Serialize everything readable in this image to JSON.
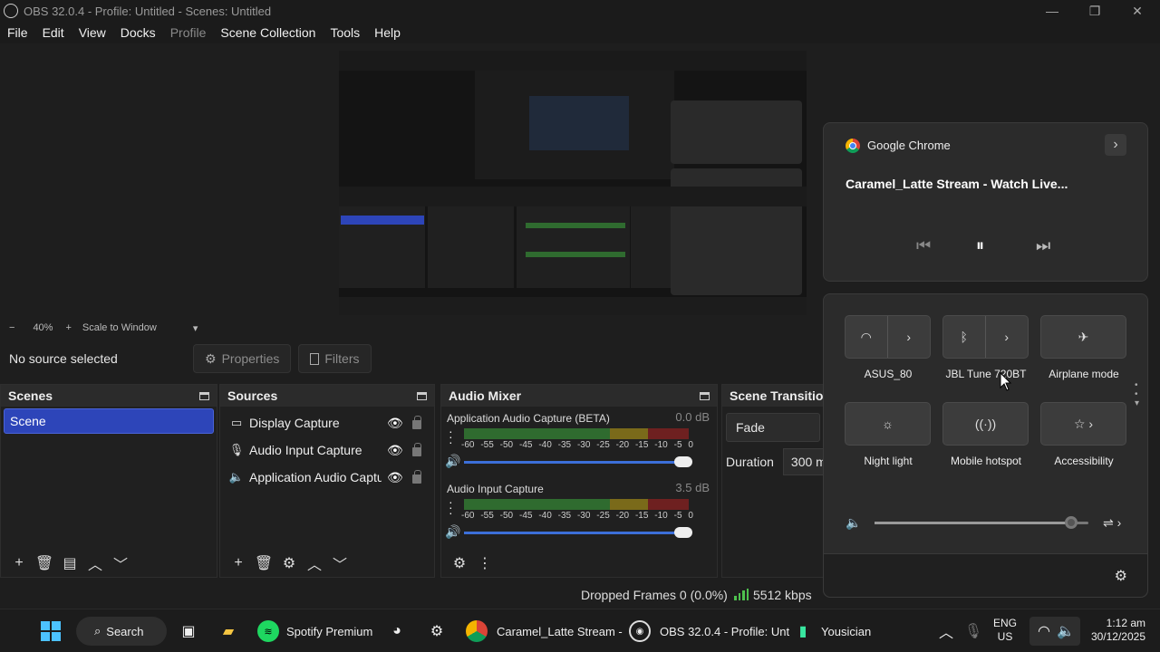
{
  "window": {
    "title": "OBS 32.0.4 - Profile: Untitled - Scenes: Untitled",
    "minimize": "—",
    "restore": "❐",
    "close": "✕"
  },
  "menu": [
    "File",
    "Edit",
    "View",
    "Docks",
    "Profile",
    "Scene Collection",
    "Tools",
    "Help"
  ],
  "preview": {
    "zoom_minus": "−",
    "zoom": "40%",
    "zoom_plus": "+",
    "scale_mode": "Scale to Window",
    "dropdown": "▾"
  },
  "context": {
    "no_source": "No source selected",
    "properties": "Properties",
    "filters": "Filters"
  },
  "scenes": {
    "title": "Scenes",
    "items": [
      "Scene"
    ]
  },
  "sources": {
    "title": "Sources",
    "items": [
      {
        "label": "Display Capture",
        "icon": "monitor-icon"
      },
      {
        "label": "Audio Input Capture",
        "icon": "microphone-icon"
      },
      {
        "label": "Application Audio Capture",
        "icon": "app-audio-icon"
      }
    ]
  },
  "mixer": {
    "title": "Audio Mixer",
    "ticks": [
      "-60",
      "-55",
      "-50",
      "-45",
      "-40",
      "-35",
      "-30",
      "-25",
      "-20",
      "-15",
      "-10",
      "-5",
      "0"
    ],
    "channels": [
      {
        "name": "Application Audio Capture (BETA)",
        "db": "0.0 dB",
        "volume": 1.0
      },
      {
        "name": "Audio Input Capture",
        "db": "3.5 dB",
        "volume": 1.0
      }
    ]
  },
  "transitions": {
    "title": "Scene Transition",
    "selected": "Fade",
    "duration_label": "Duration",
    "duration_value": "300 m"
  },
  "status": {
    "dropped": "Dropped Frames 0 (0.0%)",
    "kbps": "5512 kbps"
  },
  "media": {
    "app": "Google Chrome",
    "title": "Caramel_Latte Stream - Watch Live...",
    "prev": "⏮",
    "pause": "⏸",
    "next": "⏭",
    "expand": "›"
  },
  "quick_settings": {
    "tiles": [
      {
        "label": "ASUS_80",
        "icon": "wifi-icon"
      },
      {
        "label": "JBL Tune 720BT",
        "icon": "bluetooth-icon"
      },
      {
        "label": "Airplane mode",
        "icon": "airplane-icon"
      },
      {
        "label": "Night light",
        "icon": "night-light-icon"
      },
      {
        "label": "Mobile hotspot",
        "icon": "hotspot-icon"
      },
      {
        "label": "Accessibility",
        "icon": "accessibility-icon"
      }
    ],
    "volume": 0.92
  },
  "taskbar": {
    "search": "Search",
    "spotify": "Spotify Premium",
    "chrome": "Caramel_Latte Stream -",
    "obs": "OBS 32.0.4 - Profile: Unt",
    "yousician": "Yousician",
    "lang1": "ENG",
    "lang2": "US",
    "time": "1:12 am",
    "date": "30/12/2025"
  }
}
